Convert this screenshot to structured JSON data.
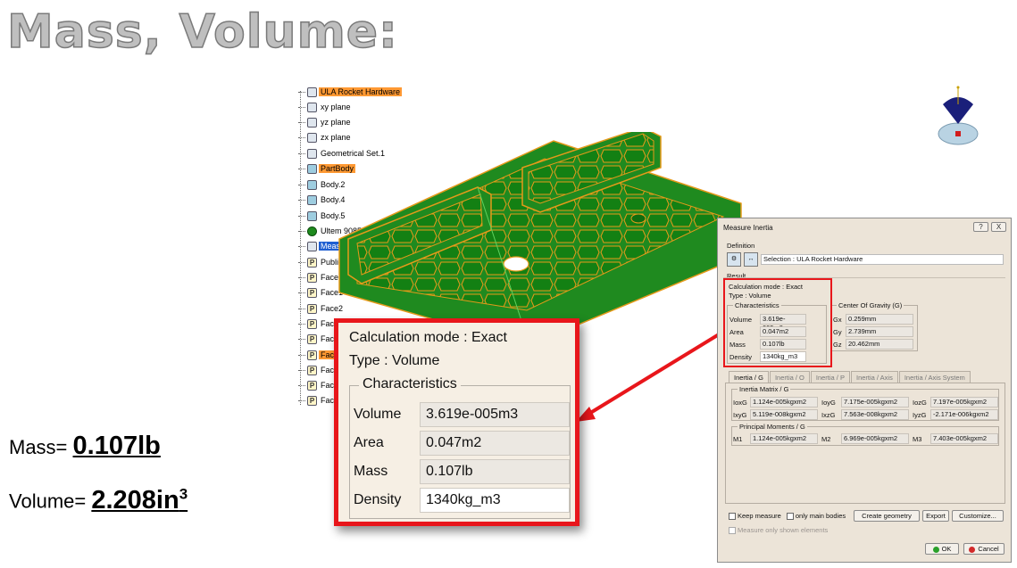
{
  "slide": {
    "title": "Mass, Volume:"
  },
  "results": {
    "mass_label": "Mass= ",
    "mass_value": "0.107lb",
    "volume_label": "Volume= ",
    "volume_value": "2.208in",
    "volume_exponent": "3"
  },
  "tree": {
    "items": [
      {
        "label": "ULA Rocket Hardware",
        "icon": "gear-icon",
        "highlight": "orange"
      },
      {
        "label": "xy plane",
        "icon": "plane-icon"
      },
      {
        "label": "yz plane",
        "icon": "plane-icon"
      },
      {
        "label": "zx plane",
        "icon": "plane-icon"
      },
      {
        "label": "Geometrical Set.1",
        "icon": "geometrical-set-icon"
      },
      {
        "label": "PartBody",
        "icon": "body-icon",
        "highlight": "orange"
      },
      {
        "label": "Body.2",
        "icon": "body-icon"
      },
      {
        "label": "Body.4",
        "icon": "body-icon"
      },
      {
        "label": "Body.5",
        "icon": "body-icon"
      },
      {
        "label": "Ultem 9085",
        "icon": "material-icon"
      },
      {
        "label": "Measure",
        "icon": "measure-icon",
        "highlight": "blue"
      },
      {
        "label": "Publication",
        "icon": "publication-icon"
      },
      {
        "label": "Face",
        "icon": "publication-icon"
      },
      {
        "label": "Face1",
        "icon": "publication-icon"
      },
      {
        "label": "Face2",
        "icon": "publication-icon"
      },
      {
        "label": "Face",
        "icon": "publication-icon"
      },
      {
        "label": "Face",
        "icon": "publication-icon"
      },
      {
        "label": "Face",
        "icon": "publication-icon",
        "highlight": "orange"
      },
      {
        "label": "Face",
        "icon": "publication-icon"
      },
      {
        "label": "Face",
        "icon": "publication-icon"
      },
      {
        "label": "Face",
        "icon": "publication-icon"
      }
    ]
  },
  "zoom": {
    "calc_mode": "Calculation mode :  Exact",
    "type": "Type :  Volume",
    "group_title": "Characteristics",
    "rows": [
      {
        "key": "Volume",
        "value": "3.619e-005m3"
      },
      {
        "key": "Area",
        "value": "0.047m2"
      },
      {
        "key": "Mass",
        "value": "0.107lb"
      },
      {
        "key": "Density",
        "value": "1340kg_m3"
      }
    ]
  },
  "dialog": {
    "title": "Measure Inertia",
    "help_button": "?",
    "close_button": "X",
    "definition_label": "Definition",
    "selection": "Selection : ULA Rocket Hardware",
    "result_label": "Result",
    "calc_mode": "Calculation mode :  Exact",
    "type": "Type :  Volume",
    "characteristics_title": "Characteristics",
    "characteristics": [
      {
        "key": "Volume",
        "value": "3.619e-005m3"
      },
      {
        "key": "Area",
        "value": "0.047m2"
      },
      {
        "key": "Mass",
        "value": "0.107lb"
      },
      {
        "key": "Density",
        "value": "1340kg_m3"
      }
    ],
    "cog_title": "Center Of Gravity (G)",
    "cog": [
      {
        "key": "Gx",
        "value": "0.259mm"
      },
      {
        "key": "Gy",
        "value": "2.739mm"
      },
      {
        "key": "Gz",
        "value": "20.462mm"
      }
    ],
    "tabs": [
      "Inertia / G",
      "Inertia / O",
      "Inertia / P",
      "Inertia / Axis",
      "Inertia / Axis System"
    ],
    "active_tab": "Inertia / G",
    "matrix_title": "Inertia Matrix / G",
    "matrix": [
      [
        {
          "key": "IoxG",
          "value": "1.124e-005kgxm2"
        },
        {
          "key": "IoyG",
          "value": "7.175e-005kgxm2"
        },
        {
          "key": "IozG",
          "value": "7.197e-005kgxm2"
        }
      ],
      [
        {
          "key": "IxyG",
          "value": "5.119e-008kgxm2"
        },
        {
          "key": "IxzG",
          "value": "7.563e-008kgxm2"
        },
        {
          "key": "IyzG",
          "value": "-2.171e-006kgxm2"
        }
      ]
    ],
    "principal_title": "Principal Moments / G",
    "principal": [
      {
        "key": "M1",
        "value": "1.124e-005kgxm2"
      },
      {
        "key": "M2",
        "value": "6.969e-005kgxm2"
      },
      {
        "key": "M3",
        "value": "7.403e-005kgxm2"
      }
    ],
    "keep_measure": "Keep measure",
    "only_main_bodies": "only main bodies",
    "create_geometry": "Create geometry",
    "export": "Export",
    "customize": "Customize...",
    "measure_shown": "Measure only shown elements",
    "ok": "OK",
    "cancel": "Cancel"
  },
  "colors": {
    "part_green": "#1f8a1f",
    "part_edge": "#e59a1a",
    "callout_red": "#e8161b",
    "title_gray": "#bfbfbf"
  }
}
